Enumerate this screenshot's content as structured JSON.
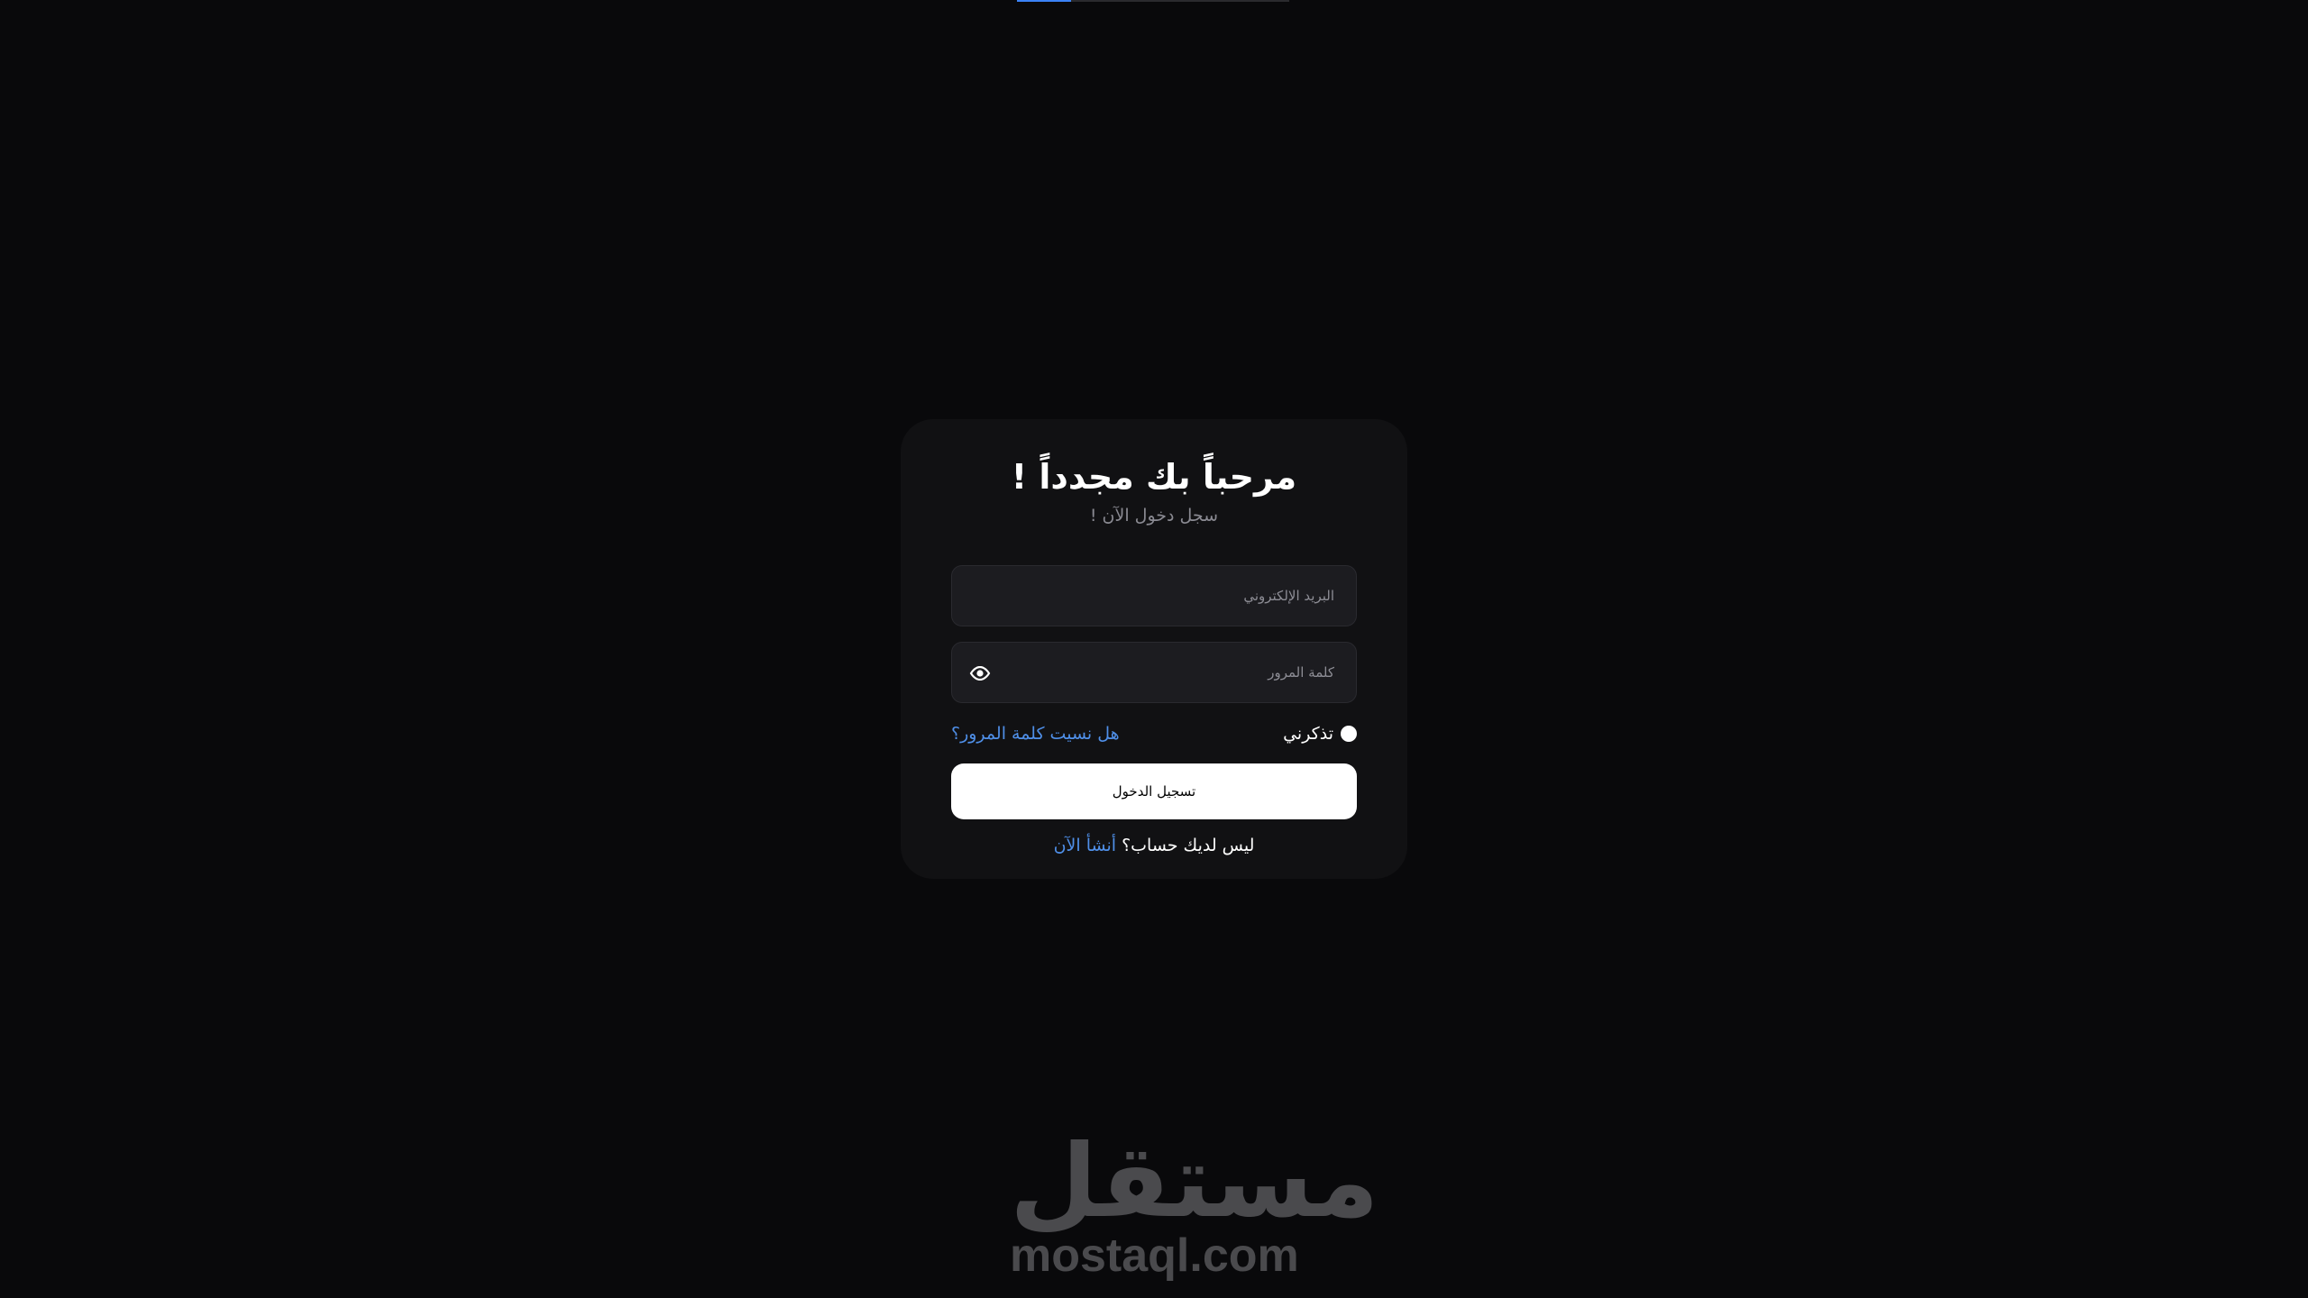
{
  "login": {
    "title": "مرحباً بك مجدداً !",
    "subtitle": "سجل دخول الآن !",
    "email_placeholder": "البريد الإلكتروني",
    "password_placeholder": "كلمة المرور",
    "remember_label": "تذكرني",
    "forgot_label": "هل نسيت كلمة المرور؟",
    "submit_label": "تسجيل الدخول",
    "signup_prompt": "ليس لديك حساب؟",
    "signup_link": "أنشأ الآن"
  },
  "watermark": {
    "arabic": "مستقل",
    "latin": "mostaql.com"
  },
  "icons": {
    "password_toggle": "eye-icon"
  },
  "colors": {
    "background": "#09090b",
    "card": "#111113",
    "field": "#1c1c20",
    "accent": "#4f8fe8",
    "button": "#ffffff"
  }
}
